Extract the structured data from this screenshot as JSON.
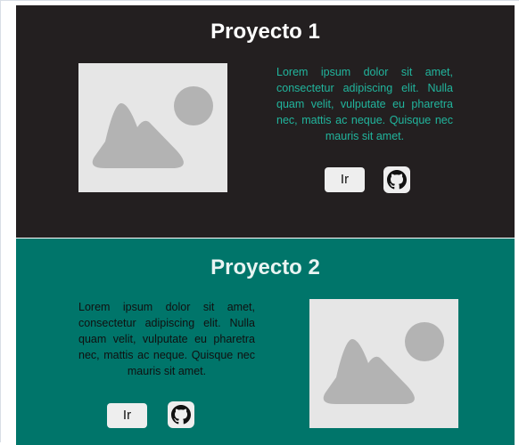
{
  "projects": [
    {
      "title": "Proyecto 1",
      "description": "Lorem ipsum dolor sit amet, consectetur adipiscing elit. Nulla quam velit, vulputate eu pharetra nec, mattis ac neque. Quisque nec mauris sit amet.",
      "button_label": "Ir",
      "image_icon": "image-placeholder-icon",
      "link_icon": "github-icon",
      "background": "#231f20",
      "text_color": "#21b59d"
    },
    {
      "title": "Proyecto 2",
      "description": "Lorem ipsum dolor sit amet, consectetur adipiscing elit. Nulla quam velit, vulputate eu pharetra nec, mattis ac neque. Quisque nec mauris sit amet.",
      "button_label": "Ir",
      "image_icon": "image-placeholder-icon",
      "link_icon": "github-icon",
      "background": "#00756a",
      "text_color": "#101010"
    }
  ]
}
